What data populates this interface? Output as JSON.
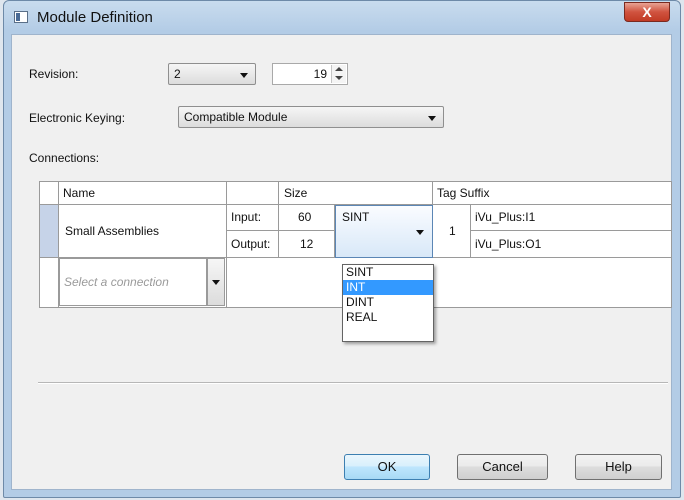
{
  "window": {
    "title": "Module Definition",
    "close_glyph": "X"
  },
  "revision": {
    "label": "Revision:",
    "major": "2",
    "minor": "19"
  },
  "electronic_keying": {
    "label": "Electronic Keying:",
    "value": "Compatible Module"
  },
  "connections": {
    "label": "Connections:",
    "headers": {
      "name": "Name",
      "size": "Size",
      "tag_suffix": "Tag Suffix"
    },
    "row": {
      "name": "Small Assemblies",
      "input_label": "Input:",
      "input_size": "60",
      "output_label": "Output:",
      "output_size": "12",
      "type": "SINT",
      "suffix_num": "1",
      "input_tag": "iVu_Plus:I1",
      "output_tag": "iVu_Plus:O1"
    },
    "new_row_placeholder": "Select a connection"
  },
  "type_dropdown": {
    "options": [
      "SINT",
      "INT",
      "DINT",
      "REAL"
    ],
    "highlighted": "INT"
  },
  "buttons": {
    "ok": "OK",
    "cancel": "Cancel",
    "help": "Help"
  },
  "icons": [
    "window-app-icon",
    "close-icon",
    "chevron-down-icon",
    "spin-up-icon",
    "spin-down-icon"
  ]
}
